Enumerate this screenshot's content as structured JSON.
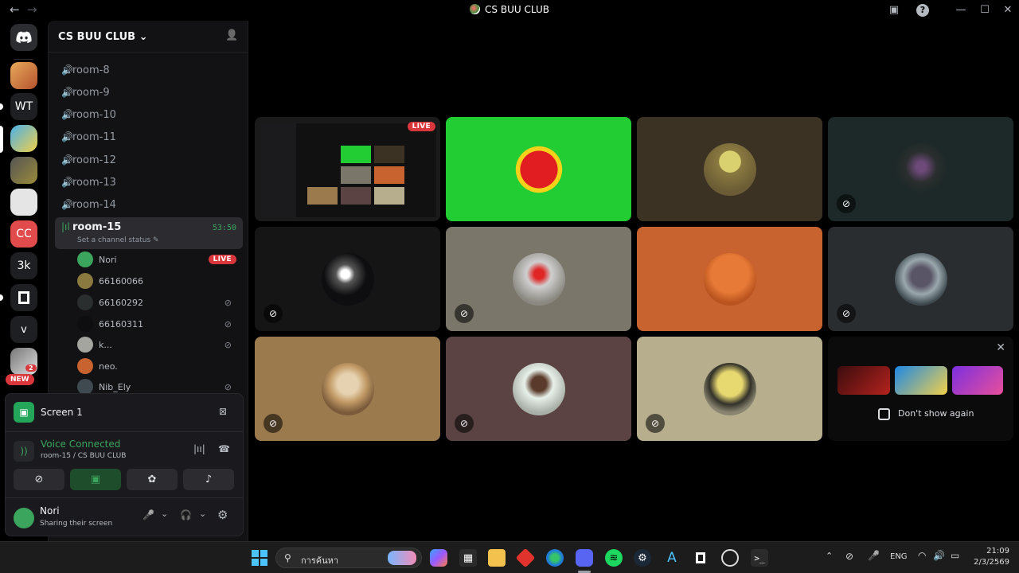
{
  "window": {
    "title": "CS BUU CLUB",
    "back_label": "←",
    "forward_label": "→",
    "inbox_icon": "▣",
    "help_icon": "?",
    "minimize_icon": "—",
    "maximize_icon": "☐",
    "close_icon": "✕"
  },
  "rail": {
    "servers": [
      {
        "label": "WT"
      },
      {
        "label": "CC"
      },
      {
        "label": "3k"
      },
      {
        "label": "v"
      }
    ],
    "badge": "2",
    "new_badge": "NEW"
  },
  "sidebar": {
    "server_name": "CS BUU CLUB",
    "chevron": "⌄",
    "invite_icon": "👤",
    "channels": [
      {
        "name": "room-8"
      },
      {
        "name": "room-9"
      },
      {
        "name": "room-10"
      },
      {
        "name": "room-11"
      },
      {
        "name": "room-12"
      },
      {
        "name": "room-13"
      },
      {
        "name": "room-14"
      }
    ],
    "active_channel": {
      "name": "room-15",
      "timer": "53:50",
      "status": "Set a channel status",
      "edit_icon": "✎"
    },
    "members": [
      {
        "name": "Nori",
        "live": "LIVE",
        "color": "#3ba55d"
      },
      {
        "name": "66160066",
        "color": "#8a7a40"
      },
      {
        "name": "66160292",
        "color": "#2a2e2e"
      },
      {
        "name": "66160311",
        "color": "#0e0e10"
      },
      {
        "name": "k...",
        "color": "#a5a5a0"
      },
      {
        "name": "neo.",
        "color": "#c8622f"
      },
      {
        "name": "Nib_Ely",
        "color": "#3e4a50"
      }
    ],
    "deafened_icon": "⊘"
  },
  "panel": {
    "stream_title": "Screen 1",
    "voice_status": "Voice Connected",
    "voice_location": "room-15 / CS BUU CLUB",
    "buttons": {
      "camera": "⊘",
      "screen": "▣",
      "activities": "✿",
      "soundboard": "♪"
    },
    "user": {
      "name": "Nori",
      "status": "Sharing their screen"
    },
    "mic_icon": "🎤",
    "headphone_icon": "🎧",
    "settings_icon": "⚙",
    "chevron": "⌄"
  },
  "grid": {
    "live_label": "LIVE",
    "muted_icon": "⊘",
    "tiles": [
      {
        "bg": "#1a1a1a",
        "type": "stream"
      },
      {
        "bg": "#22cc33",
        "avatar": "#e11d22",
        "muted": false
      },
      {
        "bg": "#3b3223",
        "avatar": "#8a7a40",
        "muted": false
      },
      {
        "bg": "#1d2828",
        "avatar": "#2a2e2e",
        "muted": true
      },
      {
        "bg": "#151516",
        "avatar": "#0e0e10",
        "muted": true
      },
      {
        "bg": "#7a7669",
        "avatar": "#a5a5a0",
        "muted": true
      },
      {
        "bg": "#c8622f",
        "avatar": "#d9742e",
        "muted": false
      },
      {
        "bg": "#2a2d2f",
        "avatar": "#3e4a50",
        "muted": true
      },
      {
        "bg": "#9b7a4e",
        "avatar": "#c29a66",
        "muted": true
      },
      {
        "bg": "#5c4343",
        "avatar": "#cfcfcf",
        "muted": true
      },
      {
        "bg": "#b6ae8c",
        "avatar": "#e8d870",
        "muted": true
      }
    ],
    "activity": {
      "dont_show": "Don't show again",
      "close_icon": "✕"
    }
  },
  "taskbar": {
    "search_placeholder": "การค้นหา",
    "lang": "ENG",
    "time": "21:09",
    "date": "2/3/2569"
  }
}
